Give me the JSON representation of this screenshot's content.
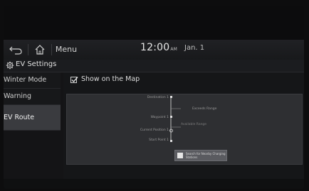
{
  "status_bar": {
    "menu_label": "Menu",
    "time": "12:00",
    "ampm": "AM",
    "date": "Jan. 1"
  },
  "header": {
    "title": "EV Settings"
  },
  "sidebar": {
    "items": [
      {
        "label": "Winter Mode"
      },
      {
        "label": "Warning"
      },
      {
        "label": "EV Route"
      }
    ]
  },
  "main": {
    "show_on_map": {
      "label": "Show on the Map",
      "checked": true
    },
    "diagram": {
      "destination": "Destination 1",
      "exceeds_range": "Exceeds Range",
      "waypoint": "Waypoint 1",
      "available_range": "Available Range",
      "current_position": "Current Position 1",
      "start_point": "Start Point 1",
      "search_button": "Search for Nearby Charging Stations"
    }
  },
  "colors": {
    "background": "#141416",
    "route_line": "#bfbfbf",
    "active_item": "#3a3b3f"
  }
}
